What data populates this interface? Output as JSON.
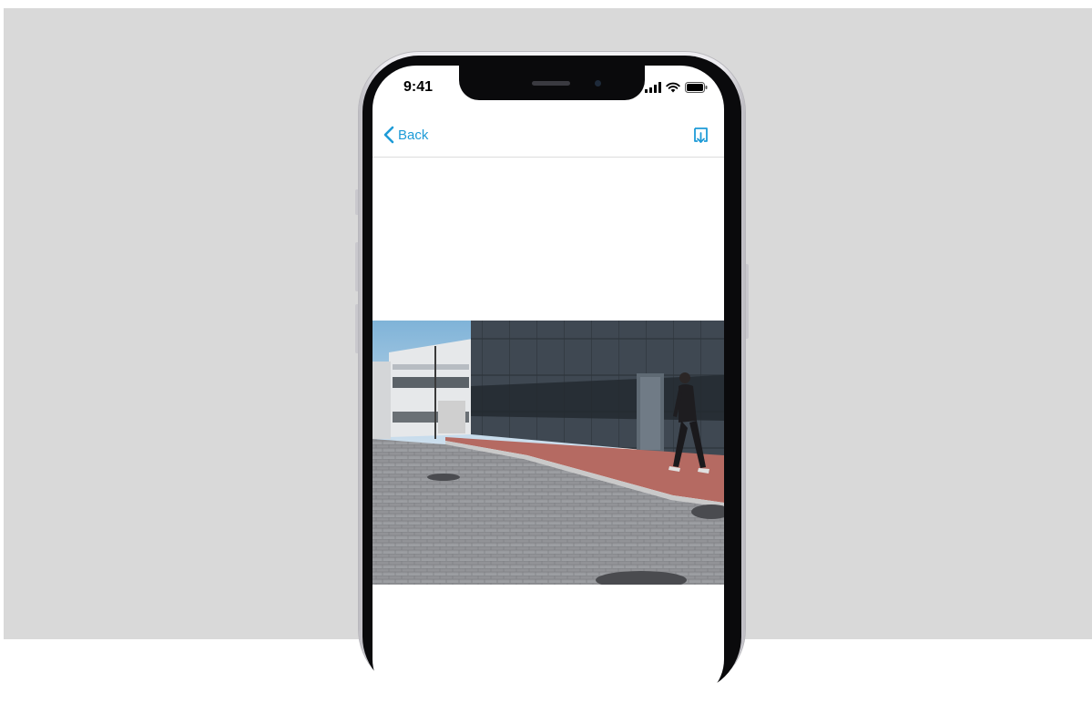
{
  "status_bar": {
    "time": "9:41",
    "icons": [
      "signal-icon",
      "wifi-icon",
      "battery-icon"
    ]
  },
  "nav": {
    "back_label": "Back",
    "back_icon": "chevron-left-icon",
    "action_icon": "download-icon"
  },
  "colors": {
    "accent": "#1e9bd7",
    "background": "#d9d9d9",
    "screen": "#ffffff"
  },
  "media": {
    "content": "video-frame",
    "scene": "person-walking-past-building"
  }
}
